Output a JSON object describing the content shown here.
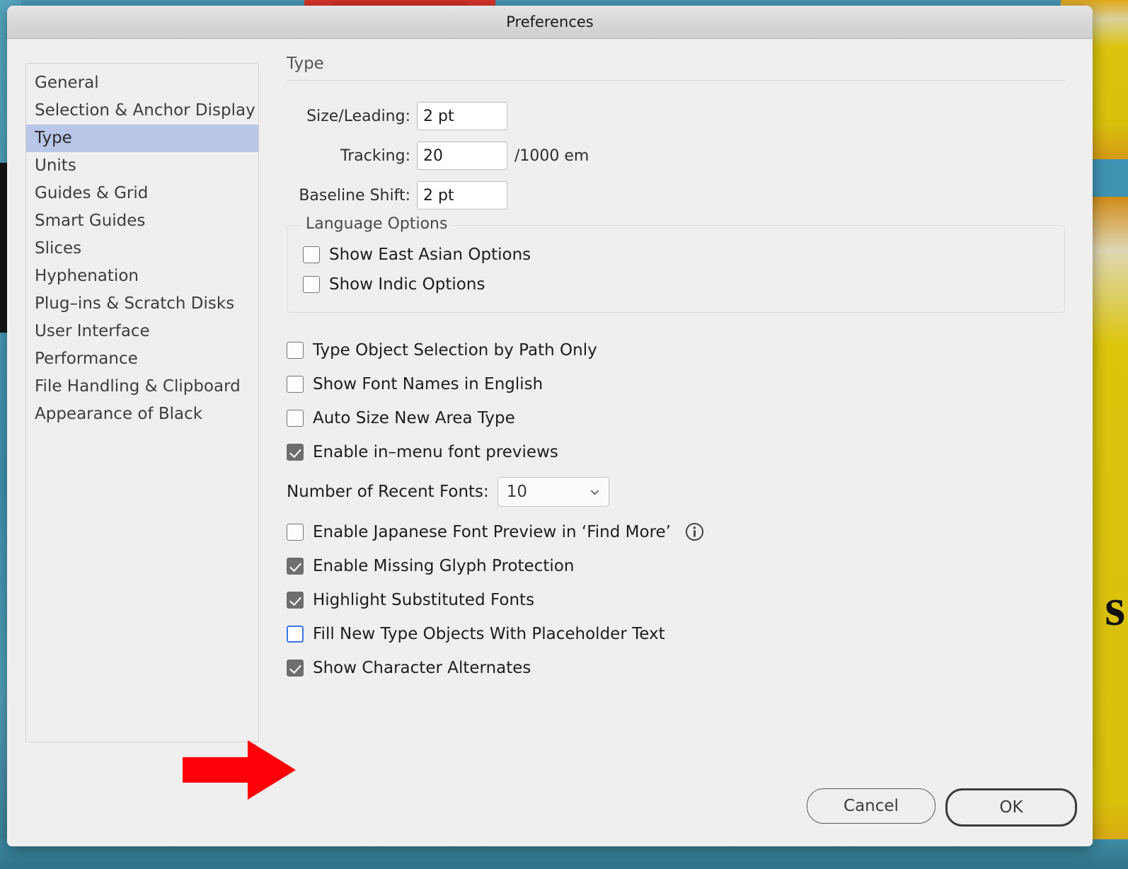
{
  "window": {
    "title": "Preferences"
  },
  "sidebar": {
    "items": [
      {
        "label": "General",
        "selected": false
      },
      {
        "label": "Selection & Anchor Display",
        "selected": false
      },
      {
        "label": "Type",
        "selected": true
      },
      {
        "label": "Units",
        "selected": false
      },
      {
        "label": "Guides & Grid",
        "selected": false
      },
      {
        "label": "Smart Guides",
        "selected": false
      },
      {
        "label": "Slices",
        "selected": false
      },
      {
        "label": "Hyphenation",
        "selected": false
      },
      {
        "label": "Plug–ins & Scratch Disks",
        "selected": false
      },
      {
        "label": "User Interface",
        "selected": false
      },
      {
        "label": "Performance",
        "selected": false
      },
      {
        "label": "File Handling & Clipboard",
        "selected": false
      },
      {
        "label": "Appearance of Black",
        "selected": false
      }
    ]
  },
  "panel": {
    "heading": "Type",
    "fields": [
      {
        "label": "Size/Leading:",
        "value": "2 pt",
        "suffix": ""
      },
      {
        "label": "Tracking:",
        "value": "20",
        "suffix": "/1000 em"
      },
      {
        "label": "Baseline Shift:",
        "value": "2 pt",
        "suffix": ""
      }
    ],
    "language_options": {
      "legend": "Language Options",
      "items": [
        {
          "label": "Show East Asian Options",
          "checked": false
        },
        {
          "label": "Show Indic Options",
          "checked": false
        }
      ]
    },
    "checkboxes_upper": [
      {
        "label": "Type Object Selection by Path Only",
        "checked": false,
        "focused": false
      },
      {
        "label": "Show Font Names in English",
        "checked": false,
        "focused": false
      },
      {
        "label": "Auto Size New Area Type",
        "checked": false,
        "focused": false
      },
      {
        "label": "Enable in–menu font previews",
        "checked": true,
        "focused": false
      }
    ],
    "recent_fonts": {
      "label": "Number of Recent Fonts:",
      "value": "10",
      "icon": "chevron-down-icon"
    },
    "checkboxes_lower": [
      {
        "label": "Enable Japanese Font Preview in ‘Find More’",
        "checked": false,
        "focused": false,
        "info": "info-icon"
      },
      {
        "label": "Enable Missing Glyph Protection",
        "checked": true,
        "focused": false,
        "info": ""
      },
      {
        "label": "Highlight Substituted Fonts",
        "checked": true,
        "focused": false,
        "info": ""
      },
      {
        "label": "Fill New Type Objects With Placeholder Text",
        "checked": false,
        "focused": true,
        "info": ""
      },
      {
        "label": "Show Character Alternates",
        "checked": true,
        "focused": false,
        "info": ""
      }
    ]
  },
  "footer": {
    "cancel_label": "Cancel",
    "ok_label": "OK"
  },
  "annotation": {
    "arrow_icon": "right-arrow-annotation",
    "arrow_color": "#fb0007",
    "points_at": "Show Character Alternates"
  },
  "background": {
    "gold_letter": "s"
  }
}
